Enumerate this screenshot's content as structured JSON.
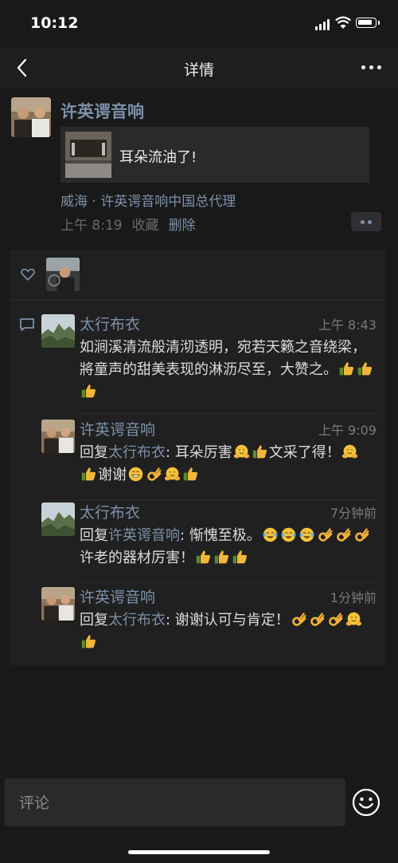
{
  "status": {
    "time": "10:12"
  },
  "nav": {
    "title": "详情"
  },
  "post": {
    "author": "许英谔音响",
    "link_text": "耳朵流油了!",
    "location": "威海 · 许英谔音响中国总代理",
    "time": "上午 8:19",
    "favorite": "收藏",
    "delete": "删除"
  },
  "comments": [
    {
      "name": "太行布衣",
      "time": "上午 8:43",
      "reply_prefix": "",
      "reply_to": "",
      "text": "如涧溪清流般清沏透明，宛若天籁之音绕梁，將童声的甜美表现的淋沥尽至，大赞之。"
    },
    {
      "name": "许英谔音响",
      "time": "上午 9:09",
      "reply_prefix": "回复",
      "reply_to": "太行布衣",
      "text_a": ": 耳朵厉害",
      "text_b": "文采了得！",
      "text_c": "谢谢"
    },
    {
      "name": "太行布衣",
      "time": "7分钟前",
      "reply_prefix": "回复",
      "reply_to": "许英谔音响",
      "text_a": ": 惭愧至极。",
      "text_b": "许老的器材厉害！"
    },
    {
      "name": "许英谔音响",
      "time": "1分钟前",
      "reply_prefix": "回复",
      "reply_to": "太行布衣",
      "text_a": ": 谢谢认可与肯定！"
    }
  ],
  "input": {
    "placeholder": "评论"
  },
  "icons": {
    "back": "chevron-left-icon",
    "more": "more-dots-icon",
    "heart": "heart-outline-icon",
    "comment": "comment-bubble-icon",
    "emoji": "emoji-smile-icon",
    "thumbs_up": "thumbs-up-emoji",
    "hug": "hugging-face-emoji",
    "grin": "grinning-emoji",
    "ok_hand": "ok-hand-emoji",
    "cry_laugh": "tears-of-joy-emoji"
  },
  "colors": {
    "background": "#191919",
    "link_blue": "#7d90a9",
    "card": "#2a2a2a",
    "panel": "#202020"
  }
}
